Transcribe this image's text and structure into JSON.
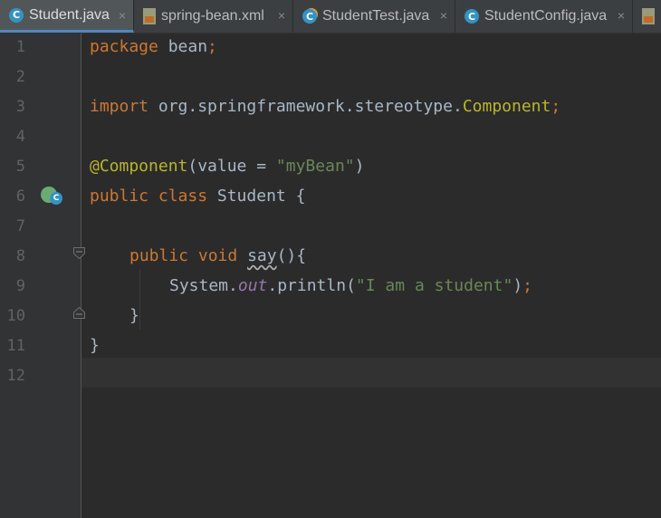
{
  "tabs": [
    {
      "label": "Student.java",
      "icon": "java-class-icon",
      "active": true
    },
    {
      "label": "spring-bean.xml",
      "icon": "xml-file-icon",
      "active": false
    },
    {
      "label": "StudentTest.java",
      "icon": "java-test-class-icon",
      "active": false
    },
    {
      "label": "StudentConfig.java",
      "icon": "java-class-icon",
      "active": false
    }
  ],
  "tab_close_glyph": "×",
  "class_icon_letter": "C",
  "line_numbers": [
    "1",
    "2",
    "3",
    "4",
    "5",
    "6",
    "7",
    "8",
    "9",
    "10",
    "11",
    "12"
  ],
  "code": {
    "l1": {
      "kw": "package",
      "rest": " bean",
      "semi": ";"
    },
    "l3": {
      "kw": "import",
      "pkg": " org.springframework.stereotype.",
      "cls": "Component",
      "semi": ";"
    },
    "l5": {
      "ann": "@Component",
      "open": "(value = ",
      "str": "\"myBean\"",
      "close": ")"
    },
    "l6": {
      "kw": "public class",
      "rest": " Student {"
    },
    "l8": {
      "kw": "public void",
      "sp": " ",
      "method": "say",
      "rest": "(){"
    },
    "l9": {
      "cls": "System.",
      "field": "out",
      "call": ".println(",
      "str": "\"I am a student\"",
      "close": ")",
      "semi": ";"
    },
    "l10": {
      "rest": "}"
    },
    "l11": {
      "rest": "}"
    }
  },
  "colors": {
    "keyword": "#cc7832",
    "annotation": "#bbb529",
    "string": "#6a8759",
    "field": "#9876aa",
    "text": "#a9b7c6",
    "background": "#2b2b2b",
    "gutter": "#313335"
  }
}
